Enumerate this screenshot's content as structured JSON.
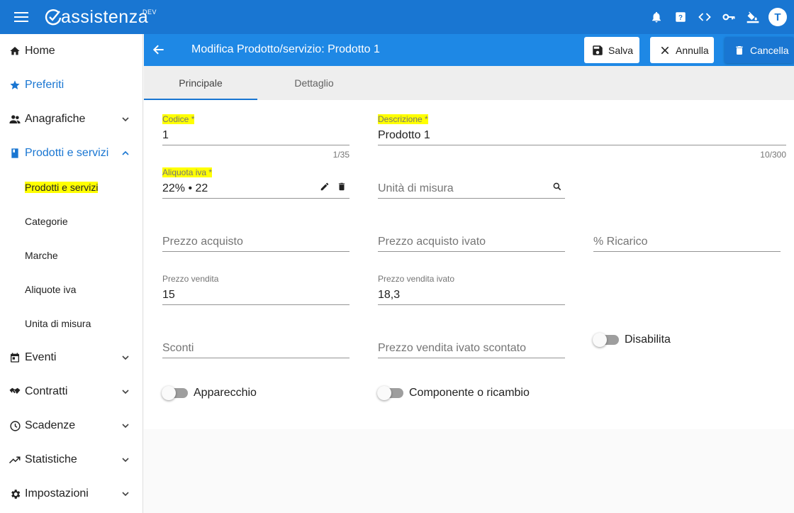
{
  "app": {
    "logo_text": "assistenza",
    "env_badge": "DEV",
    "user_initial": "T"
  },
  "sidebar": {
    "items": [
      {
        "label": "Home",
        "icon": "home-icon"
      },
      {
        "label": "Preferiti",
        "icon": "star-icon"
      },
      {
        "label": "Anagrafiche",
        "icon": "people-icon"
      },
      {
        "label": "Prodotti e servizi",
        "icon": "book-icon"
      },
      {
        "label": "Eventi",
        "icon": "calendar-icon"
      },
      {
        "label": "Contratti",
        "icon": "handshake-icon"
      },
      {
        "label": "Scadenze",
        "icon": "clock-icon"
      },
      {
        "label": "Statistiche",
        "icon": "trending-icon"
      },
      {
        "label": "Impostazioni",
        "icon": "gear-icon"
      }
    ],
    "subitems": [
      "Prodotti e servizi",
      "Categorie",
      "Marche",
      "Aliquote iva",
      "Unita di misura"
    ]
  },
  "form": {
    "title": "Modifica Prodotto/servizio: Prodotto 1",
    "save_label": "Salva",
    "cancel_label": "Annulla",
    "delete_label": "Cancella"
  },
  "tabs": [
    "Principale",
    "Dettaglio"
  ],
  "fields": {
    "codice": {
      "label": "Codice *",
      "value": "1",
      "counter": "1/35"
    },
    "descrizione": {
      "label": "Descrizione *",
      "value": "Prodotto 1",
      "counter": "10/300"
    },
    "aliquota": {
      "label": "Aliquota iva *",
      "value": "22% • 22"
    },
    "unita": {
      "placeholder": "Unità di misura"
    },
    "prezzo_acquisto": {
      "placeholder": "Prezzo acquisto"
    },
    "prezzo_acquisto_ivato": {
      "placeholder": "Prezzo acquisto ivato"
    },
    "ricarico": {
      "placeholder": "% Ricarico"
    },
    "prezzo_vendita": {
      "label": "Prezzo vendita",
      "value": "15"
    },
    "prezzo_vendita_ivato": {
      "label": "Prezzo vendita ivato",
      "value": "18,3"
    },
    "sconti": {
      "placeholder": "Sconti"
    },
    "prezzo_vendita_ivato_scontato": {
      "placeholder": "Prezzo vendita ivato scontato"
    }
  },
  "toggles": {
    "disabilita": "Disabilita",
    "apparecchio": "Apparecchio",
    "componente": "Componente o ricambio"
  },
  "colors": {
    "primary": "#1976d2",
    "header": "#1e88e5",
    "highlight": "#ffff00"
  }
}
